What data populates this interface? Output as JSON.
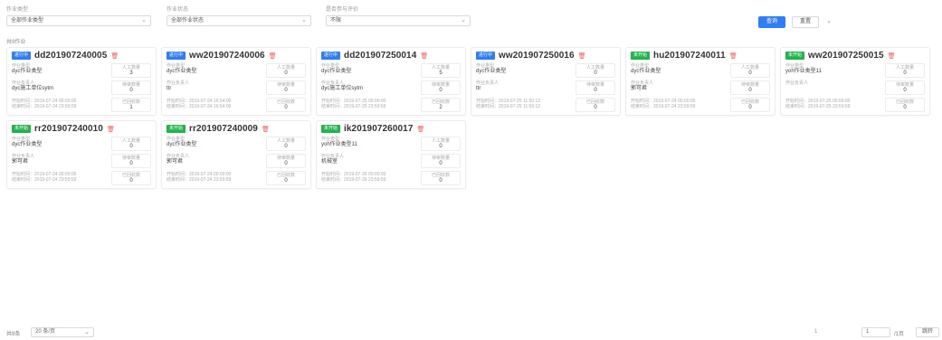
{
  "filters": {
    "type_label": "作业类型",
    "type_value": "全部作业类型",
    "status_label": "作业状态",
    "status_value": "全部作业状态",
    "participate_label": "是否参与评价",
    "participate_value": "不限",
    "query_button": "查询",
    "reset_button": "重置",
    "collapse_icon": "chevron-down-icon"
  },
  "total_label": "共9作业",
  "field_labels": {
    "name": "作业类型",
    "owner": "作业负责人",
    "start": "开始时间：",
    "end": "结束时间：",
    "participants": "人工数量",
    "completed": "待审数量",
    "cancelled": "已回收数"
  },
  "colors": {
    "tag_blue": "#2e7ef6",
    "tag_green": "#21b44b",
    "delete": "#f05a5a"
  },
  "cards": [
    {
      "tag": "进行中",
      "tag_color": "blue",
      "title": "dd201907240005",
      "type": "dyc作业类型",
      "owner": "dyc施工单位sytm",
      "start": "2019-07-24 00:00:00",
      "end": "2019-07-24 23:59:59",
      "participants": "3",
      "completed": "0",
      "cancelled": "1"
    },
    {
      "tag": "进行中",
      "tag_color": "blue",
      "title": "ww201907240006",
      "type": "dyc作业类型",
      "owner": "ttr",
      "start": "2019-07-24 16:54:00",
      "end": "2019-07-24 16:54:00",
      "participants": "0",
      "completed": "0",
      "cancelled": "0"
    },
    {
      "tag": "进行中",
      "tag_color": "blue",
      "title": "dd201907250014",
      "type": "dyc作业类型",
      "owner": "dyc施工单位sytm",
      "start": "2019-07-25 00:00:00",
      "end": "2019-07-25 23:59:59",
      "participants": "5",
      "completed": "0",
      "cancelled": "2"
    },
    {
      "tag": "进行中",
      "tag_color": "blue",
      "title": "ww201907250016",
      "type": "dyc作业类型",
      "owner": "ttr",
      "start": "2019-07-25 11:50:12",
      "end": "2019-07-25 11:50:12",
      "participants": "0",
      "completed": "0",
      "cancelled": "0"
    },
    {
      "tag": "未开始",
      "tag_color": "green",
      "title": "hu201907240011",
      "type": "dyc作业类型",
      "owner": "郭可君",
      "start": "2019-07-24 00:00:00",
      "end": "2019-07-24 23:59:59",
      "participants": "0",
      "completed": "0",
      "cancelled": "0"
    },
    {
      "tag": "未开始",
      "tag_color": "green",
      "title": "ww201907250015",
      "type": "yoh作业类型11",
      "owner": "",
      "start": "2019-07-25 00:00:00",
      "end": "2019-07-25 23:59:59",
      "participants": "0",
      "completed": "0",
      "cancelled": "0"
    },
    {
      "tag": "未开始",
      "tag_color": "green",
      "title": "rr201907240010",
      "type": "dyc作业类型",
      "owner": "郭可君",
      "start": "2019-07-24 00:00:00",
      "end": "2019-07-24 23:59:59",
      "participants": "0",
      "completed": "0",
      "cancelled": "0"
    },
    {
      "tag": "未开始",
      "tag_color": "green",
      "title": "rr201907240009",
      "type": "dyc作业类型",
      "owner": "郭可君",
      "start": "2019-07-24 00:00:00",
      "end": "2019-07-24 23:59:59",
      "participants": "0",
      "completed": "0",
      "cancelled": "0"
    },
    {
      "tag": "未开始",
      "tag_color": "green",
      "title": "ik201907260017",
      "type": "yoh作业类型11",
      "owner": "机械室",
      "start": "2019-07-26 00:00:00",
      "end": "2019-07-26 23:59:59",
      "participants": "0",
      "completed": "0",
      "cancelled": "0"
    }
  ],
  "pagination": {
    "total": "共9条",
    "page_size": "20 条/页",
    "current_page": "1",
    "jump_value": "1",
    "total_pages": "/1页",
    "go_button": "跳转"
  }
}
